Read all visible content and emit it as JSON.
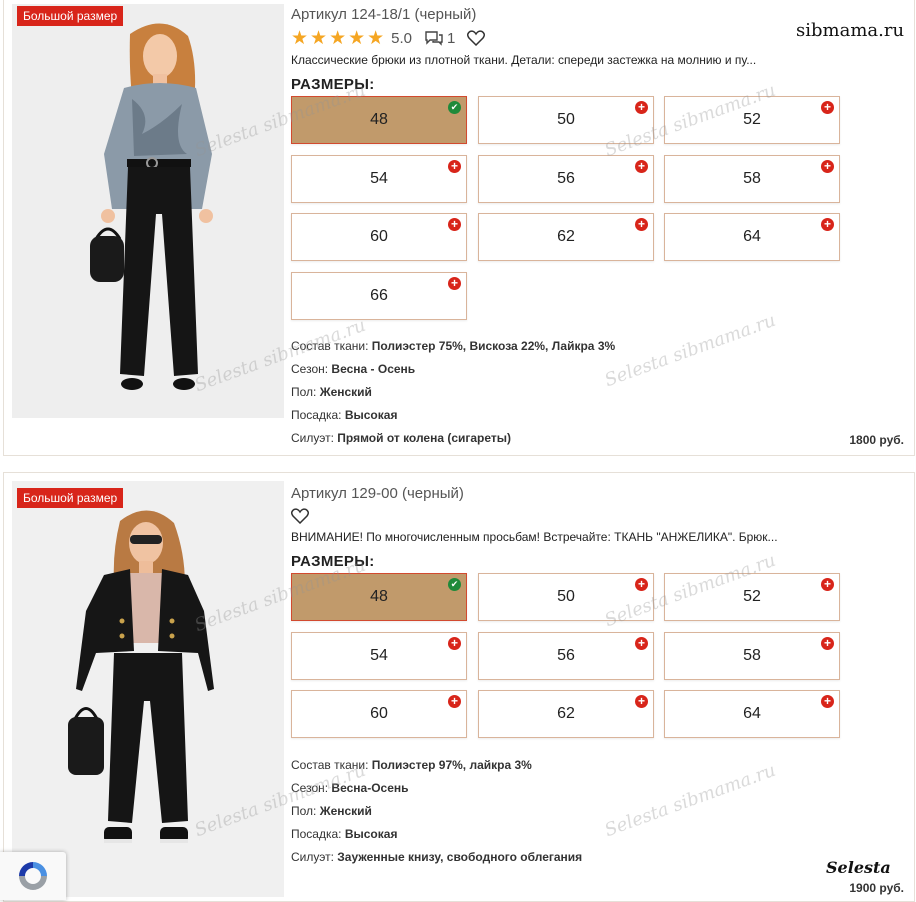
{
  "watermark": {
    "site": "sibmama.ru",
    "brand": "Selesta",
    "overlay": "Selesta sibmama.ru"
  },
  "products": [
    {
      "badge": "Большой размер",
      "title": "Артикул 124-18/1 (черный)",
      "rating": "5.0",
      "reviews": "1",
      "description": "Классические брюки из плотной ткани. Детали: спереди застежка на молнию и пу...",
      "sizes_label": "РАЗМЕРЫ:",
      "sizes": [
        "48",
        "50",
        "52",
        "54",
        "56",
        "58",
        "60",
        "62",
        "64",
        "66"
      ],
      "selected": "48",
      "specs": [
        {
          "label": "Состав ткани: ",
          "value": "Полиэстер 75%, Вискоза 22%, Лайкра 3%"
        },
        {
          "label": "Сезон: ",
          "value": "Весна - Осень"
        },
        {
          "label": "Пол: ",
          "value": "Женский"
        },
        {
          "label": "Посадка: ",
          "value": "Высокая"
        },
        {
          "label": "Силуэт: ",
          "value": "Прямой от колена (сигареты)"
        }
      ],
      "price": "1800 руб."
    },
    {
      "badge": "Большой размер",
      "title": "Артикул 129-00 (черный)",
      "description": "ВНИМАНИЕ! По многочисленным просьбам! Встречайте: ТКАНЬ \"АНЖЕЛИКА\". Брюк...",
      "sizes_label": "РАЗМЕРЫ:",
      "sizes": [
        "48",
        "50",
        "52",
        "54",
        "56",
        "58",
        "60",
        "62",
        "64"
      ],
      "selected": "48",
      "specs": [
        {
          "label": "Состав ткани: ",
          "value": "Полиэстер 97%, лайкра 3%"
        },
        {
          "label": "Сезон: ",
          "value": "Весна-Осень"
        },
        {
          "label": "Пол: ",
          "value": "Женский"
        },
        {
          "label": "Посадка: ",
          "value": "Высокая"
        },
        {
          "label": "Силуэт: ",
          "value": "Зауженные книзу, свободного облегания"
        }
      ],
      "price": "1900 руб."
    }
  ],
  "colors": {
    "accent": "#d8251a",
    "selected_size": "#c19a6b",
    "star": "#f5a623",
    "check": "#1f8a3a"
  }
}
